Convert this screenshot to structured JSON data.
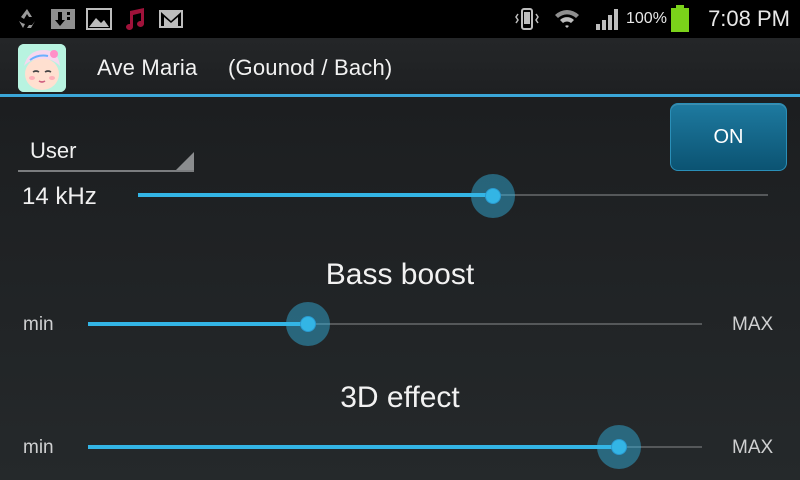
{
  "status_bar": {
    "time": "7:08 PM",
    "battery_percent": "100%",
    "icons": [
      "recycle-icon",
      "download-icon",
      "gallery-icon",
      "music-icon",
      "gmail-icon",
      "vibrate-icon",
      "wifi-icon",
      "signal-icon",
      "battery-icon"
    ],
    "battery_color": "#7bd21a"
  },
  "action_bar": {
    "title": "Ave Maria",
    "subtitle": "(Gounod / Bach)",
    "app_icon": "baby-face-icon"
  },
  "equalizer": {
    "preset": "User",
    "toggle_label": "ON",
    "band_label": "14 kHz",
    "band_level": 0.564
  },
  "bass_boost": {
    "heading": "Bass boost",
    "min_label": "min",
    "max_label": "MAX",
    "level": 0.359
  },
  "effect_3d": {
    "heading": "3D effect",
    "min_label": "min",
    "max_label": "MAX",
    "level": 0.865
  },
  "colors": {
    "accent": "#33b5e5",
    "divider": "#3aa6d8",
    "button": "#0b5372"
  }
}
